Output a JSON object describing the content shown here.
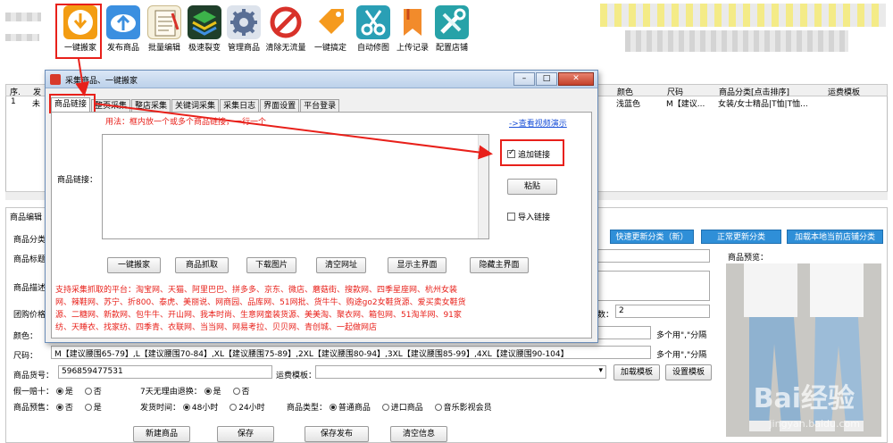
{
  "toolbar": {
    "buttons": [
      {
        "label": "一键搬家",
        "icon": "download-icon",
        "color": "#f39c12"
      },
      {
        "label": "发布商品",
        "icon": "upload-icon",
        "color": "#3b8fe0"
      },
      {
        "label": "批量编辑",
        "icon": "notepad-icon",
        "color": "#d9c38a"
      },
      {
        "label": "极速裂变",
        "icon": "layers-icon",
        "color": "#2b7a3a"
      },
      {
        "label": "管理商品",
        "icon": "gear-icon",
        "color": "#3f5f8f"
      },
      {
        "label": "清除无流量",
        "icon": "no-entry-icon",
        "color": "#d8322a"
      },
      {
        "label": "一键搞定",
        "icon": "tag-icon",
        "color": "#f59a1e"
      },
      {
        "label": "自动修图",
        "icon": "scissors-icon",
        "color": "#2a9fb5"
      },
      {
        "label": "上传记录",
        "icon": "bookmark-icon",
        "color": "#f28b2b"
      },
      {
        "label": "配置店铺",
        "icon": "tools-icon",
        "color": "#27a2a8"
      }
    ]
  },
  "grid": {
    "headers_left": [
      "序.",
      "发"
    ],
    "headers_right": [
      "颜色",
      "尺码",
      "商品分类[点击排序]",
      "运费模板"
    ],
    "row": {
      "no": "1",
      "left": "未",
      "color": "浅蓝色",
      "size": "M【建议...",
      "category": "女装/女士精品|T恤|T恤..."
    }
  },
  "dialog": {
    "title": "采集商品、一键搬家",
    "tabs": [
      "商品链接",
      "整页采集",
      "整店采集",
      "关键词采集",
      "采集日志",
      "界面设置",
      "平台登录"
    ],
    "hint": "用法：框内放一个或多个商品链接，一行一个",
    "video_link": "->查看视频演示",
    "link_label": "商品链接：",
    "append_link": "追加链接",
    "paste": "粘贴",
    "import_link": "导入链接",
    "actions": [
      "一键搬家",
      "商品抓取",
      "下载图片",
      "清空网址",
      "显示主界面",
      "隐藏主界面"
    ],
    "platforms": "支持采集抓取的平台：淘宝网、天猫、阿里巴巴、拼多多、京东、微店、蘑菇街、搜款网、四季星座网、杭州女装网、辣鞋网、苏宁、折800、泰虎、美丽说、网商园、品库网、51网批、货牛牛、购途go2女鞋货源、爱买卖女鞋货源、二糖网、新款网、包牛牛、开山网、我本时尚、生意网童装货源、美美淘、聚衣网、箱包网、51淘羊网、91家纺、天睡衣、找家纺、四季青、衣联网、当当网、网易考拉、贝贝网、青创城、一起做网店"
  },
  "form": {
    "section": "商品编辑",
    "labels": {
      "category": "商品分类",
      "title": "商品标题",
      "desc": "商品描述",
      "group_price": "团购价格",
      "color": "颜色：",
      "size": "尺码："
    },
    "category_buttons": [
      "快速更新分类（新）",
      "正常更新分类",
      "加载本地当前店铺分类"
    ],
    "preview_label": "商品预览：",
    "count_label": "数：",
    "count_value": "2",
    "multi_hint": "多个用\",\"分隔",
    "size_value": "M【建议腰围65-79】,L【建议腰围70-84】,XL【建议腰围75-89】,2XL【建议腰围80-94】,3XL【建议腰围85-99】,4XL【建议腰围90-104】",
    "sku_label": "商品货号：",
    "sku_value": "596859477531",
    "freight_label": "运费模板：",
    "load_template": "加载模板",
    "set_template": "设置模板",
    "fake_label": "假一赔十：",
    "fake_yes": "是",
    "fake_no": "否",
    "return_label": "7天无理由退换：",
    "return_yes": "是",
    "return_no": "否",
    "presale_label": "商品预售：",
    "presale_no": "否",
    "presale_yes": "是",
    "ship_label": "发货时间：",
    "ship_48": "48小时",
    "ship_24": "24小时",
    "type_label": "商品类型：",
    "type_normal": "普通商品",
    "type_import": "进口商品",
    "type_music": "音乐影视会员",
    "bottom_buttons": [
      "新建商品",
      "保存",
      "保存发布",
      "清空信息"
    ]
  },
  "watermark": {
    "main": "Bai经验",
    "sub": "jingyan.baidu.com"
  }
}
